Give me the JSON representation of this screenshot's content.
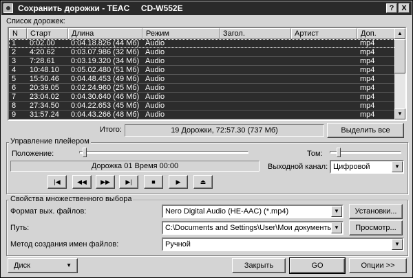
{
  "window": {
    "title": "Сохранить дорожки - TEAC     CD-W552E",
    "help_btn": "?",
    "close_btn": "X"
  },
  "tracklist": {
    "label": "Список дорожек:",
    "columns": [
      "N",
      "Старт",
      "Длина",
      "Режим",
      "Загол.",
      "Артист",
      "Доп."
    ],
    "rows": [
      {
        "n": "1",
        "start": "0:02.00",
        "length": "0:04.18.826 (44 Мб)",
        "mode": "Audio",
        "title": "",
        "artist": "",
        "ext": "mp4"
      },
      {
        "n": "2",
        "start": "4:20.62",
        "length": "0:03.07.986 (32 Мб)",
        "mode": "Audio",
        "title": "",
        "artist": "",
        "ext": "mp4"
      },
      {
        "n": "3",
        "start": "7:28.61",
        "length": "0:03.19.320 (34 Мб)",
        "mode": "Audio",
        "title": "",
        "artist": "",
        "ext": "mp4"
      },
      {
        "n": "4",
        "start": "10:48.10",
        "length": "0:05.02.480 (51 Мб)",
        "mode": "Audio",
        "title": "",
        "artist": "",
        "ext": "mp4"
      },
      {
        "n": "5",
        "start": "15:50.46",
        "length": "0:04.48.453 (49 Мб)",
        "mode": "Audio",
        "title": "",
        "artist": "",
        "ext": "mp4"
      },
      {
        "n": "6",
        "start": "20:39.05",
        "length": "0:02.24.960 (25 Мб)",
        "mode": "Audio",
        "title": "",
        "artist": "",
        "ext": "mp4"
      },
      {
        "n": "7",
        "start": "23:04.02",
        "length": "0:04.30.640 (46 Мб)",
        "mode": "Audio",
        "title": "",
        "artist": "",
        "ext": "mp4"
      },
      {
        "n": "8",
        "start": "27:34.50",
        "length": "0:04.22.653 (45 Мб)",
        "mode": "Audio",
        "title": "",
        "artist": "",
        "ext": "mp4"
      },
      {
        "n": "9",
        "start": "31:57.24",
        "length": "0:04.43.266 (48 Мб)",
        "mode": "Audio",
        "title": "",
        "artist": "",
        "ext": "mp4"
      }
    ]
  },
  "total": {
    "label": "Итого:",
    "value": "19 Дорожки,   72:57.30 (737 Мб)"
  },
  "select_all_btn": "Выделить все",
  "player": {
    "group_title": "Управление плейером",
    "position_label": "Положение:",
    "position_level": 0.02,
    "status": "Дорожка 01 Время 00:00",
    "volume_label": "Том:",
    "volume_level": 0.1,
    "output_label": "Выходной канал:",
    "output_value": "Цифровой",
    "controls": [
      "first-track",
      "rewind",
      "fast-forward",
      "last-track",
      "stop",
      "play",
      "eject"
    ]
  },
  "props": {
    "group_title": "Свойства множественного выбора",
    "format_label": "Формат вых. файлов:",
    "format_value": "Nero Digital Audio (HE-AAC) (*.mp4)",
    "settings_btn": "Установки...",
    "path_label": "Путь:",
    "path_value": "C:\\Documents and Settings\\User\\Мои документы",
    "browse_btn": "Просмотр...",
    "naming_label": "Метод создания имен файлов:",
    "naming_value": "Ручной"
  },
  "bottom": {
    "disk_btn": "Диск",
    "close_btn": "Закрыть",
    "go_btn": "GO",
    "options_btn": "Опции >>"
  }
}
